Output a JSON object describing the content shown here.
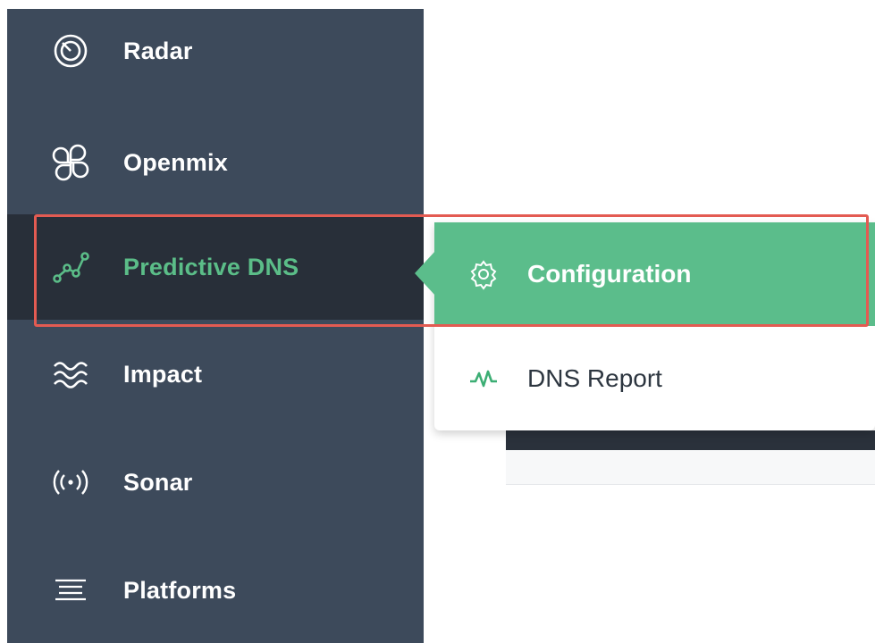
{
  "sidebar": {
    "items": [
      {
        "label": "Radar",
        "icon": "radar-icon"
      },
      {
        "label": "Openmix",
        "icon": "openmix-icon"
      },
      {
        "label": "Predictive DNS",
        "icon": "predictive-dns-icon"
      },
      {
        "label": "Impact",
        "icon": "impact-icon"
      },
      {
        "label": "Sonar",
        "icon": "sonar-icon"
      },
      {
        "label": "Platforms",
        "icon": "platforms-icon"
      }
    ],
    "active_index": 2
  },
  "flyout": {
    "items": [
      {
        "label": "Configuration",
        "icon": "gear-icon"
      },
      {
        "label": "DNS Report",
        "icon": "pulse-icon"
      }
    ],
    "active_index": 0
  },
  "colors": {
    "sidebar_bg": "#3d4a5b",
    "sidebar_active_bg": "#282f39",
    "accent_green": "#5bbd8b",
    "highlight_red": "#e35b52"
  }
}
